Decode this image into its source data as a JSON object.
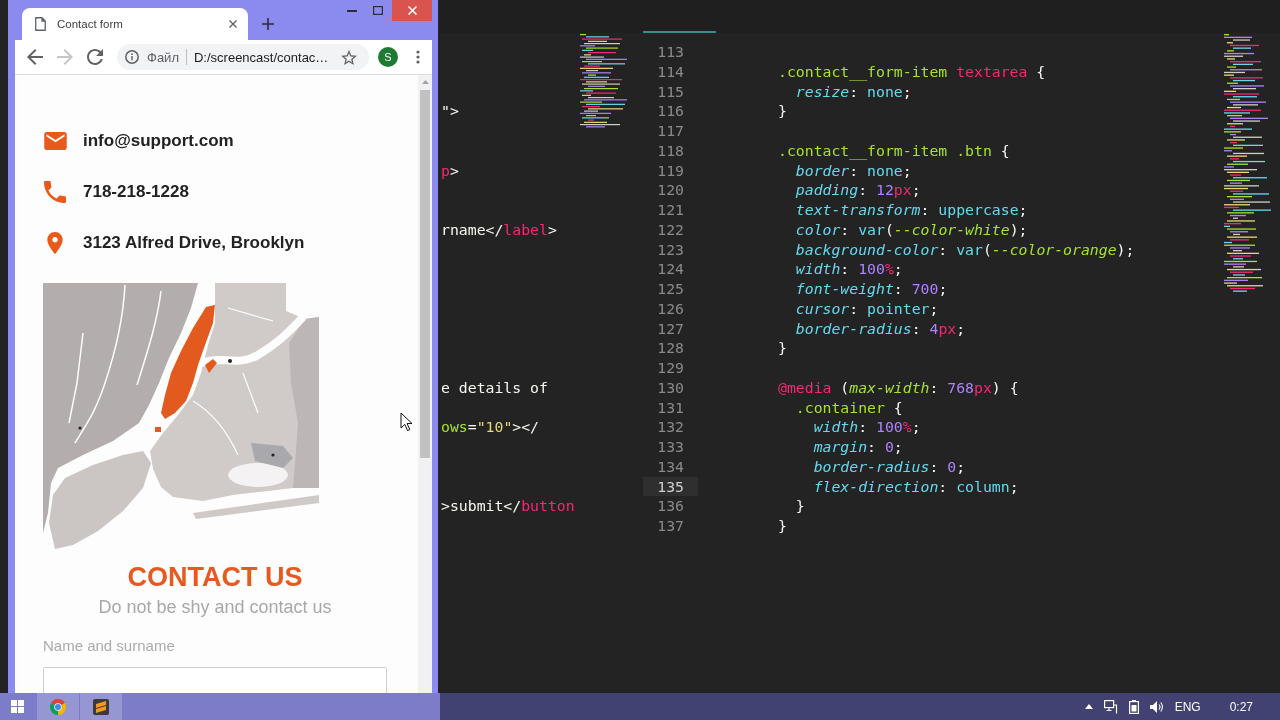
{
  "browser": {
    "tabs": [
      {
        "title": "Contact form",
        "selected": true
      }
    ],
    "nav_buttons": [
      {
        "kind": "back",
        "disabled": false
      },
      {
        "kind": "forward",
        "disabled": true
      },
      {
        "kind": "reload",
        "disabled": false
      }
    ],
    "address_bar": {
      "site_label": "Файл",
      "url": "D:/screencast/contac…"
    },
    "profile": {
      "initial": "S"
    }
  },
  "page": {
    "contacts": [
      {
        "kind": "email",
        "text": "info@support.com"
      },
      {
        "kind": "phone",
        "text": "718-218-1228"
      },
      {
        "kind": "address",
        "text": "3123 Alfred Drive, Brooklyn"
      }
    ],
    "heading": "CONTACT US",
    "subheading": "Do not be shy and contact us",
    "fields": [
      {
        "label": "Name and surname"
      }
    ]
  },
  "editor": {
    "left_pane": {
      "lines": [
        {
          "kind": "blank"
        },
        {
          "kind": "blank"
        },
        {
          "kind": "blank"
        },
        {
          "kind": "code",
          "tokens": [
            {
              "text": "\">",
              "kind": "p"
            }
          ]
        },
        {
          "kind": "blank"
        },
        {
          "kind": "blank"
        },
        {
          "kind": "code",
          "tokens": [
            {
              "text": "p",
              "kind": "tag"
            },
            {
              "text": ">",
              "kind": "p"
            }
          ]
        },
        {
          "kind": "blank"
        },
        {
          "kind": "blank"
        },
        {
          "kind": "code",
          "tokens": [
            {
              "text": "rname</",
              "kind": "p"
            },
            {
              "text": "label",
              "kind": "tag"
            },
            {
              "text": ">",
              "kind": "p"
            }
          ]
        },
        {
          "kind": "blank"
        },
        {
          "kind": "blank"
        },
        {
          "kind": "blank"
        },
        {
          "kind": "blank"
        },
        {
          "kind": "blank"
        },
        {
          "kind": "blank"
        },
        {
          "kind": "blank"
        },
        {
          "kind": "code",
          "tokens": [
            {
              "text": "e details of",
              "kind": "txt"
            }
          ]
        },
        {
          "kind": "blank"
        },
        {
          "kind": "code",
          "tokens": [
            {
              "text": "ows",
              "kind": "attr"
            },
            {
              "text": "=",
              "kind": "p"
            },
            {
              "text": "\"10\"",
              "kind": "str"
            },
            {
              "text": "></",
              "kind": "p"
            }
          ]
        },
        {
          "kind": "blank"
        },
        {
          "kind": "blank"
        },
        {
          "kind": "blank"
        },
        {
          "kind": "code",
          "tokens": [
            {
              "text": ">submit</",
              "kind": "p"
            },
            {
              "text": "button",
              "kind": "tag"
            }
          ]
        },
        {
          "kind": "blank"
        }
      ]
    },
    "right_pane": {
      "lines": [
        {
          "number": "113",
          "current": false
        },
        {
          "number": "114",
          "current": false,
          "tokens": [
            {
              "text": ".contact__form-item",
              "kind": "sel"
            },
            {
              "text": " textarea",
              "kind": "tag"
            },
            {
              "text": " {",
              "kind": "p"
            }
          ],
          "children": [
            {
              "number": "115",
              "current": false,
              "tokens": [
                {
                  "text": "resize",
                  "kind": "prop"
                },
                {
                  "text": ": ",
                  "kind": "p"
                },
                {
                  "text": "none",
                  "kind": "val"
                },
                {
                  "text": ";",
                  "kind": "p"
                }
              ]
            }
          ]
        },
        {
          "number": "116",
          "current": false,
          "tokens": [
            {
              "text": "}",
              "kind": "p"
            }
          ]
        },
        {
          "number": "117",
          "current": false
        },
        {
          "number": "118",
          "current": false,
          "tokens": [
            {
              "text": ".contact__form-item .btn",
              "kind": "sel"
            },
            {
              "text": " {",
              "kind": "p"
            }
          ],
          "children": [
            {
              "number": "119",
              "current": false,
              "tokens": [
                {
                  "text": "border",
                  "kind": "prop"
                },
                {
                  "text": ": ",
                  "kind": "p"
                },
                {
                  "text": "none",
                  "kind": "val"
                },
                {
                  "text": ";",
                  "kind": "p"
                }
              ]
            },
            {
              "number": "120",
              "current": false,
              "tokens": [
                {
                  "text": "padding",
                  "kind": "prop"
                },
                {
                  "text": ": ",
                  "kind": "p"
                },
                {
                  "text": "12",
                  "kind": "num"
                },
                {
                  "text": "px",
                  "kind": "unit"
                },
                {
                  "text": ";",
                  "kind": "p"
                }
              ]
            },
            {
              "number": "121",
              "current": false,
              "tokens": [
                {
                  "text": "text-transform",
                  "kind": "prop"
                },
                {
                  "text": ": ",
                  "kind": "p"
                },
                {
                  "text": "uppercase",
                  "kind": "val"
                },
                {
                  "text": ";",
                  "kind": "p"
                }
              ]
            },
            {
              "number": "122",
              "current": false,
              "tokens": [
                {
                  "text": "color",
                  "kind": "prop"
                },
                {
                  "text": ": ",
                  "kind": "p"
                },
                {
                  "text": "var",
                  "kind": "fn"
                },
                {
                  "text": "(",
                  "kind": "p"
                },
                {
                  "text": "--color-white",
                  "kind": "var"
                },
                {
                  "text": ");",
                  "kind": "p"
                }
              ]
            },
            {
              "number": "123",
              "current": false,
              "tokens": [
                {
                  "text": "background-color",
                  "kind": "prop"
                },
                {
                  "text": ": ",
                  "kind": "p"
                },
                {
                  "text": "var",
                  "kind": "fn"
                },
                {
                  "text": "(",
                  "kind": "p"
                },
                {
                  "text": "--color-orange",
                  "kind": "var"
                },
                {
                  "text": ");",
                  "kind": "p"
                }
              ]
            },
            {
              "number": "124",
              "current": false,
              "tokens": [
                {
                  "text": "width",
                  "kind": "prop"
                },
                {
                  "text": ": ",
                  "kind": "p"
                },
                {
                  "text": "100",
                  "kind": "num"
                },
                {
                  "text": "%",
                  "kind": "unit"
                },
                {
                  "text": ";",
                  "kind": "p"
                }
              ]
            },
            {
              "number": "125",
              "current": false,
              "tokens": [
                {
                  "text": "font-weight",
                  "kind": "prop"
                },
                {
                  "text": ": ",
                  "kind": "p"
                },
                {
                  "text": "700",
                  "kind": "num"
                },
                {
                  "text": ";",
                  "kind": "p"
                }
              ]
            },
            {
              "number": "126",
              "current": false,
              "tokens": [
                {
                  "text": "cursor",
                  "kind": "prop"
                },
                {
                  "text": ": ",
                  "kind": "p"
                },
                {
                  "text": "pointer",
                  "kind": "val"
                },
                {
                  "text": ";",
                  "kind": "p"
                }
              ]
            },
            {
              "number": "127",
              "current": false,
              "tokens": [
                {
                  "text": "border-radius",
                  "kind": "prop"
                },
                {
                  "text": ": ",
                  "kind": "p"
                },
                {
                  "text": "4",
                  "kind": "num"
                },
                {
                  "text": "px",
                  "kind": "unit"
                },
                {
                  "text": ";",
                  "kind": "p"
                }
              ]
            }
          ]
        },
        {
          "number": "128",
          "current": false,
          "tokens": [
            {
              "text": "}",
              "kind": "p"
            }
          ]
        },
        {
          "number": "129",
          "current": false
        },
        {
          "number": "130",
          "current": false,
          "tokens": [
            {
              "text": "@media",
              "kind": "at"
            },
            {
              "text": " (",
              "kind": "p"
            },
            {
              "text": "max-width",
              "kind": "feat"
            },
            {
              "text": ": ",
              "kind": "p"
            },
            {
              "text": "768",
              "kind": "num"
            },
            {
              "text": "px",
              "kind": "unit"
            },
            {
              "text": ") {",
              "kind": "p"
            }
          ],
          "children": [
            {
              "number": "131",
              "current": false,
              "tokens": [
                {
                  "text": ".container",
                  "kind": "sel"
                },
                {
                  "text": " {",
                  "kind": "p"
                }
              ],
              "children": [
                {
                  "number": "132",
                  "current": false,
                  "tokens": [
                    {
                      "text": "width",
                      "kind": "prop"
                    },
                    {
                      "text": ": ",
                      "kind": "p"
                    },
                    {
                      "text": "100",
                      "kind": "num"
                    },
                    {
                      "text": "%",
                      "kind": "unit"
                    },
                    {
                      "text": ";",
                      "kind": "p"
                    }
                  ]
                },
                {
                  "number": "133",
                  "current": false,
                  "tokens": [
                    {
                      "text": "margin",
                      "kind": "prop"
                    },
                    {
                      "text": ": ",
                      "kind": "p"
                    },
                    {
                      "text": "0",
                      "kind": "num"
                    },
                    {
                      "text": ";",
                      "kind": "p"
                    }
                  ]
                },
                {
                  "number": "134",
                  "current": false,
                  "tokens": [
                    {
                      "text": "border-radius",
                      "kind": "prop"
                    },
                    {
                      "text": ": ",
                      "kind": "p"
                    },
                    {
                      "text": "0",
                      "kind": "num"
                    },
                    {
                      "text": ";",
                      "kind": "p"
                    }
                  ]
                },
                {
                  "number": "135",
                  "current": true,
                  "tokens": [
                    {
                      "text": "flex-direction",
                      "kind": "prop"
                    },
                    {
                      "text": ": ",
                      "kind": "p"
                    },
                    {
                      "text": "column",
                      "kind": "val"
                    },
                    {
                      "text": ";",
                      "kind": "p"
                    }
                  ]
                }
              ]
            },
            {
              "number": "136",
              "current": false,
              "tokens": [
                {
                  "text": "}",
                  "kind": "p"
                }
              ]
            }
          ]
        },
        {
          "number": "137",
          "current": false,
          "tokens": [
            {
              "text": "}",
              "kind": "p"
            }
          ]
        }
      ]
    }
  },
  "taskbar": {
    "apps": [
      {
        "kind": "browser"
      },
      {
        "kind": "editor"
      }
    ],
    "language": "ENG",
    "time": "0:27"
  }
}
